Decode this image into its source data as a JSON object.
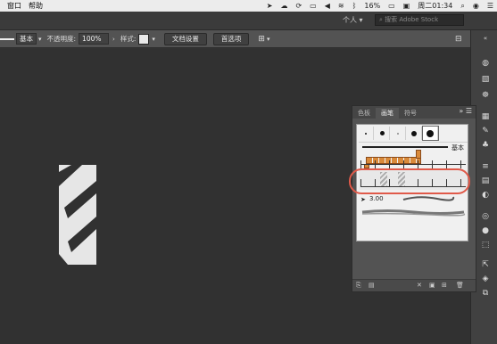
{
  "menubar": {
    "items": [
      "窗口",
      "帮助"
    ],
    "battery": "16%",
    "clock": "周二01:34"
  },
  "topbar": {
    "workspace": "个人",
    "stock_placeholder": "搜索 Adobe Stock"
  },
  "controlbar": {
    "stroke_label": "基本",
    "opacity_label": "不透明度:",
    "opacity_value": "100%",
    "style_label": "样式:",
    "doc_setup": "文档设置",
    "prefs": "首选项"
  },
  "panel": {
    "tabs": [
      "色板",
      "画笔",
      "符号"
    ],
    "active_tab": "画笔",
    "basic_label": "基本",
    "calligraphic_size": "3.00"
  },
  "colors": {
    "highlight": "#e05a4a",
    "pattern_brush": "#d98a3a"
  }
}
